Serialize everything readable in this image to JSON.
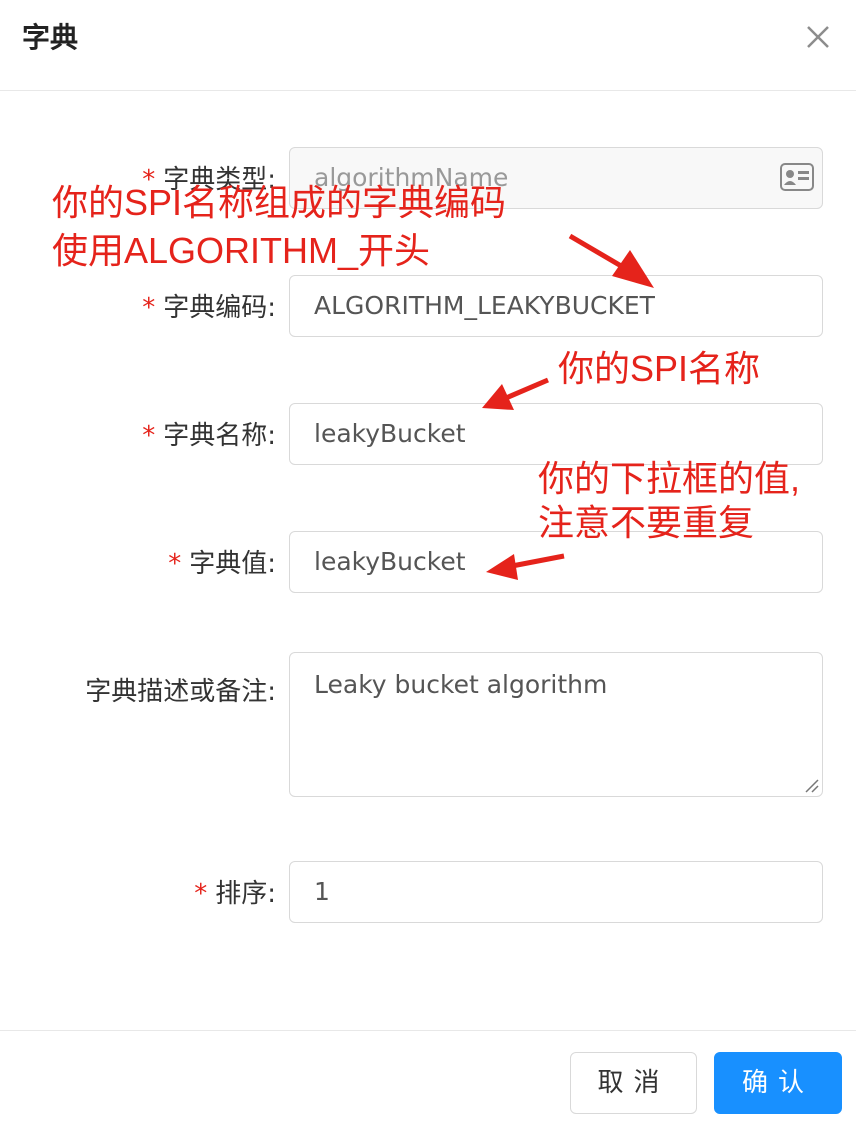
{
  "dialog": {
    "title": "字典"
  },
  "form": {
    "type": {
      "required": "*",
      "label": "字典类型:",
      "value": "algorithmName"
    },
    "code": {
      "required": "*",
      "label": "字典编码:",
      "value": "ALGORITHM_LEAKYBUCKET"
    },
    "name": {
      "required": "*",
      "label": "字典名称:",
      "value": "leakyBucket"
    },
    "value": {
      "required": "*",
      "label": "字典值:",
      "value": "leakyBucket"
    },
    "desc": {
      "label": "字典描述或备注:",
      "value": "Leaky bucket algorithm"
    },
    "sort": {
      "required": "*",
      "label": "排序:",
      "value": "1"
    }
  },
  "buttons": {
    "cancel": "取消",
    "confirm": "确认"
  },
  "annotations": {
    "a1_line1": "你的SPI名称组成的字典编码",
    "a1_line2": "使用ALGORITHM_开头",
    "a2": "你的SPI名称",
    "a3_line1": "你的下拉框的值,",
    "a3_line2": "注意不要重复"
  },
  "colors": {
    "primary": "#1890ff",
    "annotation": "#e5231b",
    "required": "#e5231b"
  },
  "icons": {
    "close": "close-icon",
    "type_field": "id-card-icon"
  }
}
